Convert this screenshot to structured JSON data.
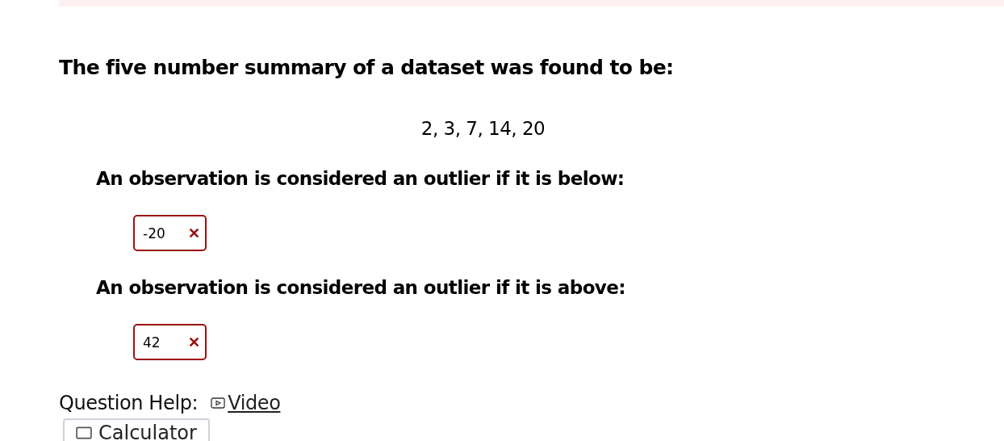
{
  "question": {
    "prompt": "The five number summary of a dataset was found to be:",
    "summary": "2, 3, 7, 14, 20",
    "parts": [
      {
        "label": "An observation is considered an outlier if it is below:",
        "answer": "-20",
        "correct": false
      },
      {
        "label": "An observation is considered an outlier if it is above:",
        "answer": "42",
        "correct": false
      }
    ]
  },
  "help": {
    "label": "Question Help:",
    "links": [
      {
        "text": "Video",
        "kind": "video"
      }
    ],
    "buttons": [
      {
        "text": "Calculator",
        "kind": "calculator"
      }
    ]
  }
}
